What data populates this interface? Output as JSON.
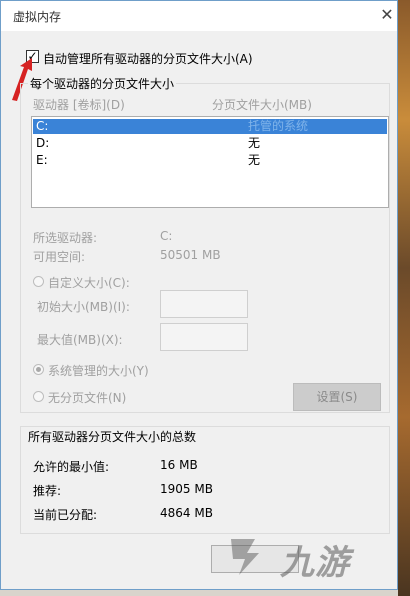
{
  "window": {
    "title": "虚拟内存",
    "close_glyph": "✕"
  },
  "auto_manage": {
    "label": "自动管理所有驱动器的分页文件大小(A)",
    "checked": true,
    "check_glyph": "✓"
  },
  "per_drive": {
    "group_title": "每个驱动器的分页文件大小",
    "col_drive": "驱动器 [卷标](D)",
    "col_size": "分页文件大小(MB)",
    "rows": [
      {
        "drive": "C:",
        "size": "托管的系统",
        "selected": true
      },
      {
        "drive": "D:",
        "size": "无",
        "selected": false
      },
      {
        "drive": "E:",
        "size": "无",
        "selected": false
      }
    ],
    "selected_drive_label": "所选驱动器:",
    "selected_drive_value": "C:",
    "free_space_label": "可用空间:",
    "free_space_value": "50501 MB",
    "custom_size_label": "自定义大小(C):",
    "initial_size_label": "初始大小(MB)(I):",
    "initial_size_value": "",
    "max_size_label": "最大值(MB)(X):",
    "max_size_value": "",
    "system_managed_label": "系统管理的大小(Y)",
    "no_paging_label": "无分页文件(N)",
    "set_button": "设置(S)",
    "selected_option": "system_managed"
  },
  "totals": {
    "group_title": "所有驱动器分页文件大小的总数",
    "min_label": "允许的最小值:",
    "min_value": "16 MB",
    "recommended_label": "推荐:",
    "recommended_value": "1905 MB",
    "current_label": "当前已分配:",
    "current_value": "4864 MB"
  },
  "watermark": {
    "text": "九游"
  },
  "colors": {
    "selection": "#3a83d7",
    "arrow": "#d62222",
    "disabled_text": "#a0a0a0"
  }
}
